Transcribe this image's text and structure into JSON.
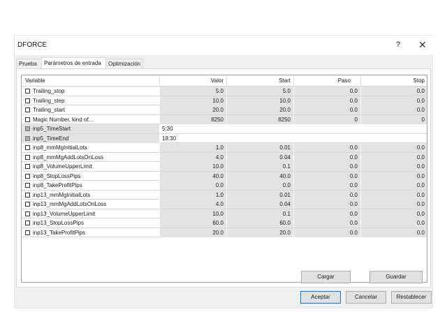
{
  "window": {
    "title": "DFORCE",
    "help": "?",
    "close": "✕"
  },
  "tabs": [
    "Prueba",
    "Parámetros de entrada",
    "Optimización"
  ],
  "columns": {
    "variable": "Variable",
    "valor": "Valor",
    "start": "Start",
    "paso": "Paso",
    "stop": "Stop"
  },
  "rows": [
    {
      "name": "Trailing_stop",
      "valor": "5.0",
      "start": "5.0",
      "paso": "0.0",
      "stop": "0.0",
      "checkbox": "enabled"
    },
    {
      "name": "Trailing_step",
      "valor": "10.0",
      "start": "10.0",
      "paso": "0.0",
      "stop": "0.0",
      "checkbox": "enabled"
    },
    {
      "name": "Trailing_start",
      "valor": "20.0",
      "start": "20.0",
      "paso": "0.0",
      "stop": "0.0",
      "checkbox": "enabled"
    },
    {
      "name": "Magic Number, kind of...",
      "valor": "8250",
      "start": "8250",
      "paso": "0",
      "stop": "0",
      "checkbox": "enabled"
    },
    {
      "name": "inp5_TimeStart",
      "valor": "5:30",
      "start": "",
      "paso": "",
      "stop": "",
      "checkbox": "disabled"
    },
    {
      "name": "inp5_TimeEnd",
      "valor": "18:30",
      "start": "",
      "paso": "",
      "stop": "",
      "checkbox": "disabled"
    },
    {
      "name": "inp8_mmMgInitialLots",
      "valor": "1.0",
      "start": "0.01",
      "paso": "0.0",
      "stop": "0.0",
      "checkbox": "enabled"
    },
    {
      "name": "inp8_mmMgAddLotsOnLoss",
      "valor": "4.0",
      "start": "0.04",
      "paso": "0.0",
      "stop": "0.0",
      "checkbox": "enabled"
    },
    {
      "name": "inp8_VolumeUpperLimit",
      "valor": "10.0",
      "start": "0.1",
      "paso": "0.0",
      "stop": "0.0",
      "checkbox": "enabled"
    },
    {
      "name": "inp8_StopLossPips",
      "valor": "40.0",
      "start": "40.0",
      "paso": "0.0",
      "stop": "0.0",
      "checkbox": "enabled"
    },
    {
      "name": "inp8_TakeProfitPips",
      "valor": "0.0",
      "start": "0.0",
      "paso": "0.0",
      "stop": "0.0",
      "checkbox": "enabled"
    },
    {
      "name": "inp13_mmMgInitialLots",
      "valor": "1.0",
      "start": "0.01",
      "paso": "0.0",
      "stop": "0.0",
      "checkbox": "enabled"
    },
    {
      "name": "inp13_mmMgAddLotsOnLoss",
      "valor": "4.0",
      "start": "0.04",
      "paso": "0.0",
      "stop": "0.0",
      "checkbox": "enabled"
    },
    {
      "name": "inp13_VolumeUpperLimit",
      "valor": "10.0",
      "start": "0.1",
      "paso": "0.0",
      "stop": "0.0",
      "checkbox": "enabled"
    },
    {
      "name": "inp13_StopLossPips",
      "valor": "60.0",
      "start": "60.0",
      "paso": "0.0",
      "stop": "0.0",
      "checkbox": "enabled"
    },
    {
      "name": "inp13_TakeProfitPips",
      "valor": "20.0",
      "start": "20.0",
      "paso": "0.0",
      "stop": "0.0",
      "checkbox": "enabled"
    }
  ],
  "buttons": {
    "cargar": "Cargar",
    "guardar": "Guardar",
    "aceptar": "Aceptar",
    "cancelar": "Cancelar",
    "restablecer": "Restablecer"
  },
  "colors": {
    "accent": "#0078d7",
    "row_shade": "#e3e3e3"
  }
}
